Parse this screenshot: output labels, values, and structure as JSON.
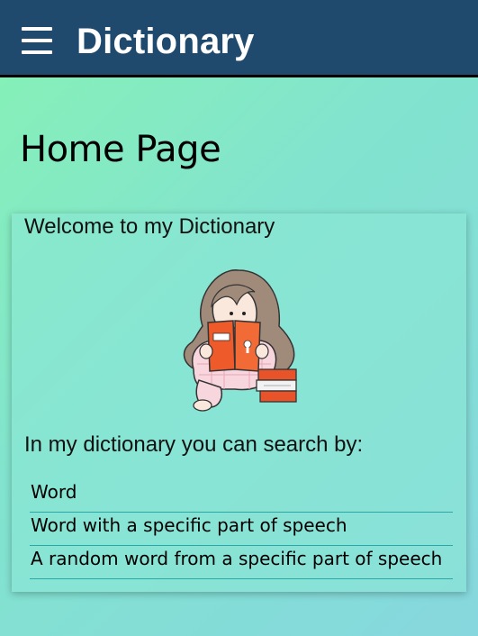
{
  "header": {
    "menu_icon": "hamburger-menu-icon",
    "title": "Dictionary",
    "background_color": "#1f4a6d"
  },
  "main": {
    "page_title": "Home Page",
    "card": {
      "welcome": "Welcome to my Dictionary",
      "illustration": "girl-reading-book-illustration",
      "intro": "In my dictionary you can search by:",
      "options": [
        {
          "label": "Word"
        },
        {
          "label": "Word with a specific part of speech"
        },
        {
          "label": "A random word from a specific part of speech"
        }
      ]
    }
  },
  "colors": {
    "background_gradient_start": "#86f2b4",
    "background_gradient_end": "#86d7de",
    "option_underline": "#2aa7a7"
  }
}
